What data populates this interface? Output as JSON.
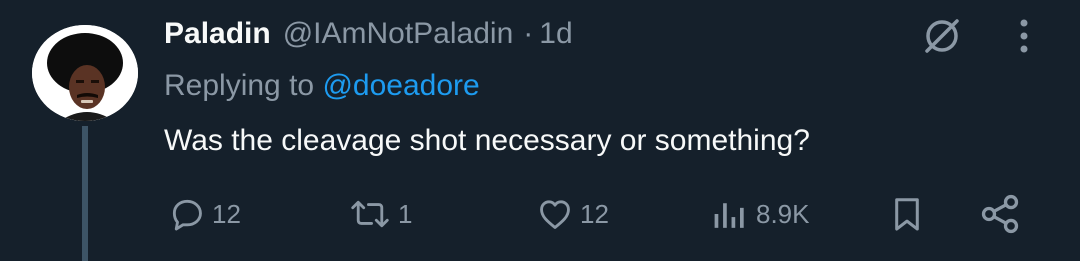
{
  "tweet": {
    "display_name": "Paladin",
    "handle": "@IAmNotPaladin",
    "separator": "·",
    "time": "1d",
    "replying_prefix": "Replying to ",
    "replying_to": "@doeadore",
    "text": "Was the cleavage shot necessary or something?"
  },
  "actions": {
    "replies": "12",
    "retweets": "1",
    "likes": "12",
    "views": "8.9K"
  },
  "icons": {
    "grok": "grok-icon",
    "more": "more-vertical-icon",
    "reply": "reply-icon",
    "retweet": "retweet-icon",
    "like": "heart-icon",
    "views": "views-chart-icon",
    "bookmark": "bookmark-icon",
    "share": "share-icon"
  },
  "colors": {
    "background": "#15202b",
    "text_primary": "#f7f9f9",
    "text_secondary": "#8b98a5",
    "link": "#1d9bf0",
    "thread_line": "#3d5466"
  }
}
